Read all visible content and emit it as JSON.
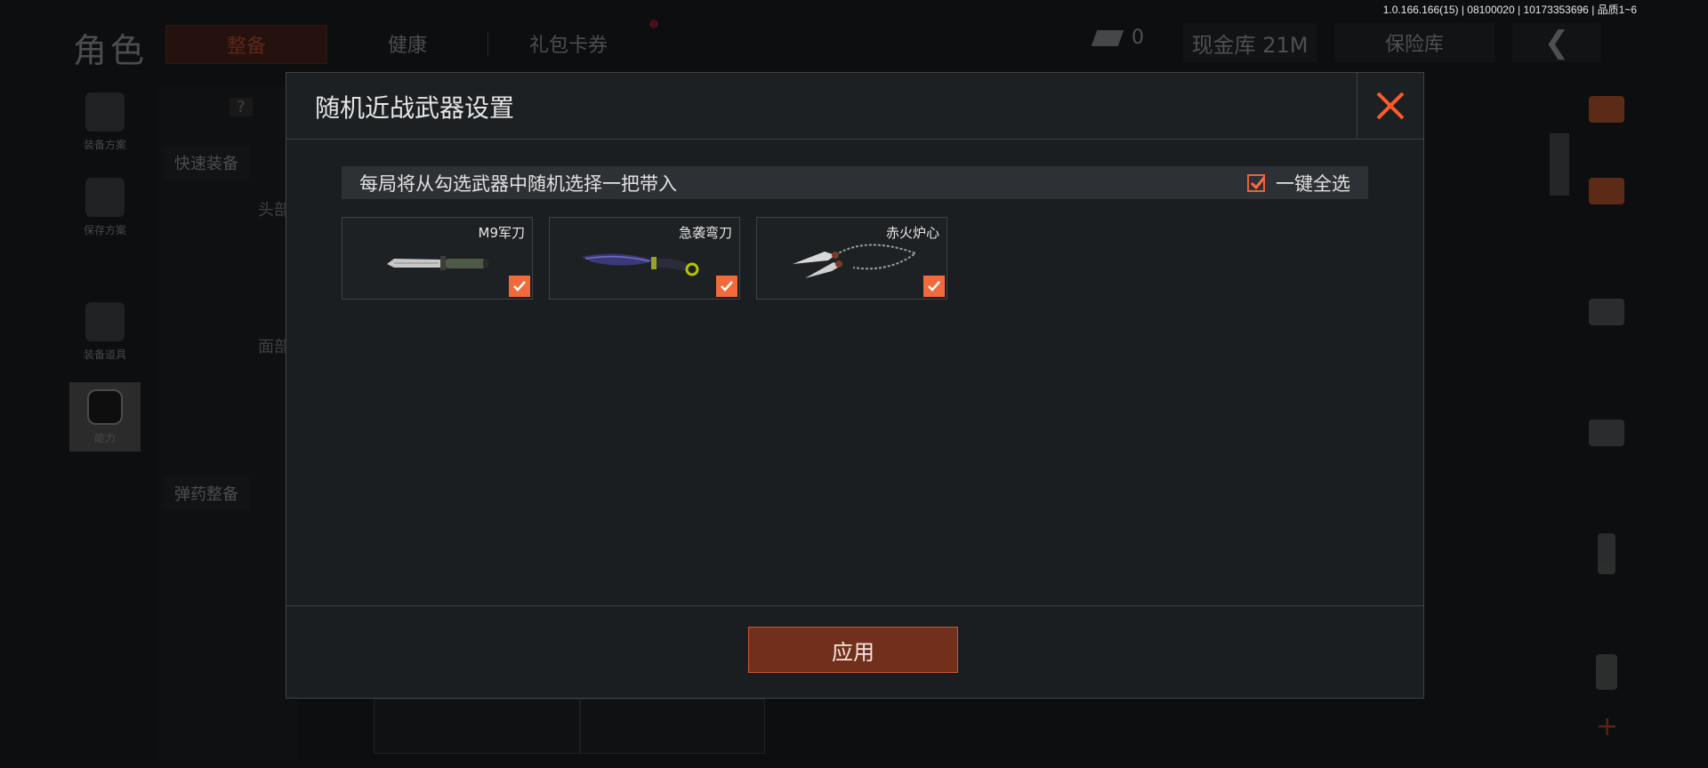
{
  "version_info": "1.0.166.166(15) | 08100020 | 10173353696 | 品质1~6",
  "background": {
    "page_title": "角色",
    "tabs": [
      {
        "label": "整备",
        "active": true
      },
      {
        "label": "健康",
        "active": false
      },
      {
        "label": "礼包卡券",
        "active": false
      }
    ],
    "currency_count": "0",
    "cash_vault": "现金库 21M",
    "safe_vault": "保险库",
    "left_sidebar": [
      {
        "label": "装备方案"
      },
      {
        "label": "保存方案"
      },
      {
        "label": "装备道具"
      },
      {
        "label": "能力"
      }
    ],
    "left_panel": {
      "quick_equip": "快速装备",
      "head_label": "头部",
      "face_label": "面部",
      "ammo_equip": "弹药整备",
      "help": "?"
    }
  },
  "modal": {
    "title": "随机近战武器设置",
    "description": "每局将从勾选武器中随机选择一把带入",
    "select_all_label": "一键全选",
    "select_all_checked": true,
    "weapons": [
      {
        "name": "M9军刀",
        "checked": true,
        "icon": "combat-knife"
      },
      {
        "name": "急袭弯刀",
        "checked": true,
        "icon": "karambit-knife"
      },
      {
        "name": "赤火炉心",
        "checked": true,
        "icon": "chain-blades"
      }
    ],
    "apply_label": "应用"
  },
  "colors": {
    "accent": "#f06a3c",
    "apply_bg": "#722f1b",
    "modal_bg": "#1b1e21"
  }
}
